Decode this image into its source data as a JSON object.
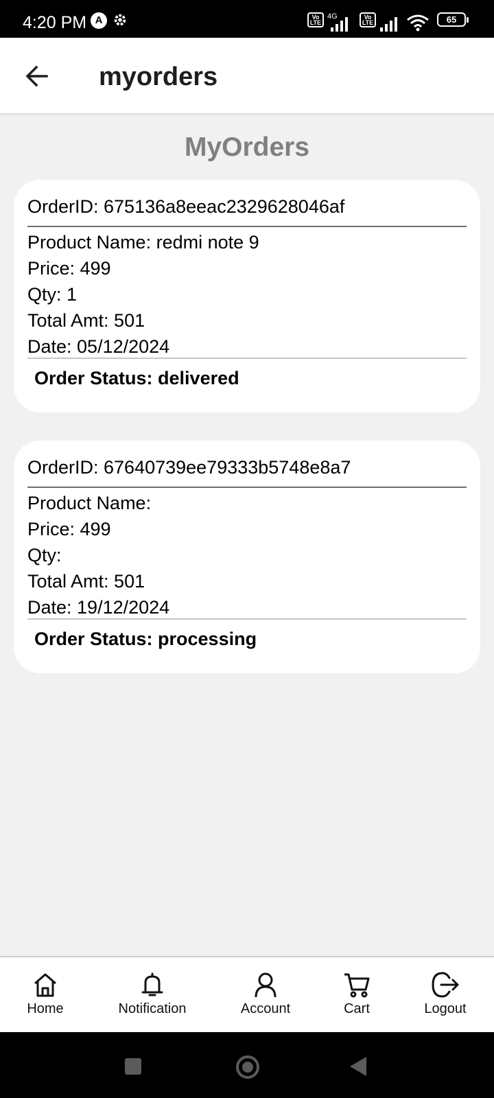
{
  "status_bar": {
    "time": "4:20 PM",
    "network": "4G",
    "volte_label": "Vo LTE",
    "battery": "65"
  },
  "app_bar": {
    "title": "myorders",
    "back_icon": "arrow-left-icon"
  },
  "page_heading": "MyOrders",
  "orders": [
    {
      "order_id": "OrderID: 675136a8eeac2329628046af",
      "product_name": "Product Name: redmi note 9",
      "price": "Price: 499",
      "qty": "Qty: 1",
      "total": "Total Amt: 501",
      "date": "Date: 05/12/2024",
      "status": "Order Status: delivered"
    },
    {
      "order_id": "OrderID: 67640739ee79333b5748e8a7",
      "product_name": "Product Name:",
      "price": "Price: 499",
      "qty": "Qty:",
      "total": "Total Amt: 501",
      "date": "Date: 19/12/2024",
      "status": "Order Status: processing"
    }
  ],
  "bottom_nav": [
    {
      "label": "Home",
      "icon": "home-icon"
    },
    {
      "label": "Notification",
      "icon": "bell-icon"
    },
    {
      "label": "Account",
      "icon": "user-icon"
    },
    {
      "label": "Cart",
      "icon": "cart-icon"
    },
    {
      "label": "Logout",
      "icon": "logout-icon"
    }
  ],
  "colors": {
    "page_background": "#f1f1f1",
    "card_background": "#ffffff",
    "heading_gray": "#808080"
  }
}
